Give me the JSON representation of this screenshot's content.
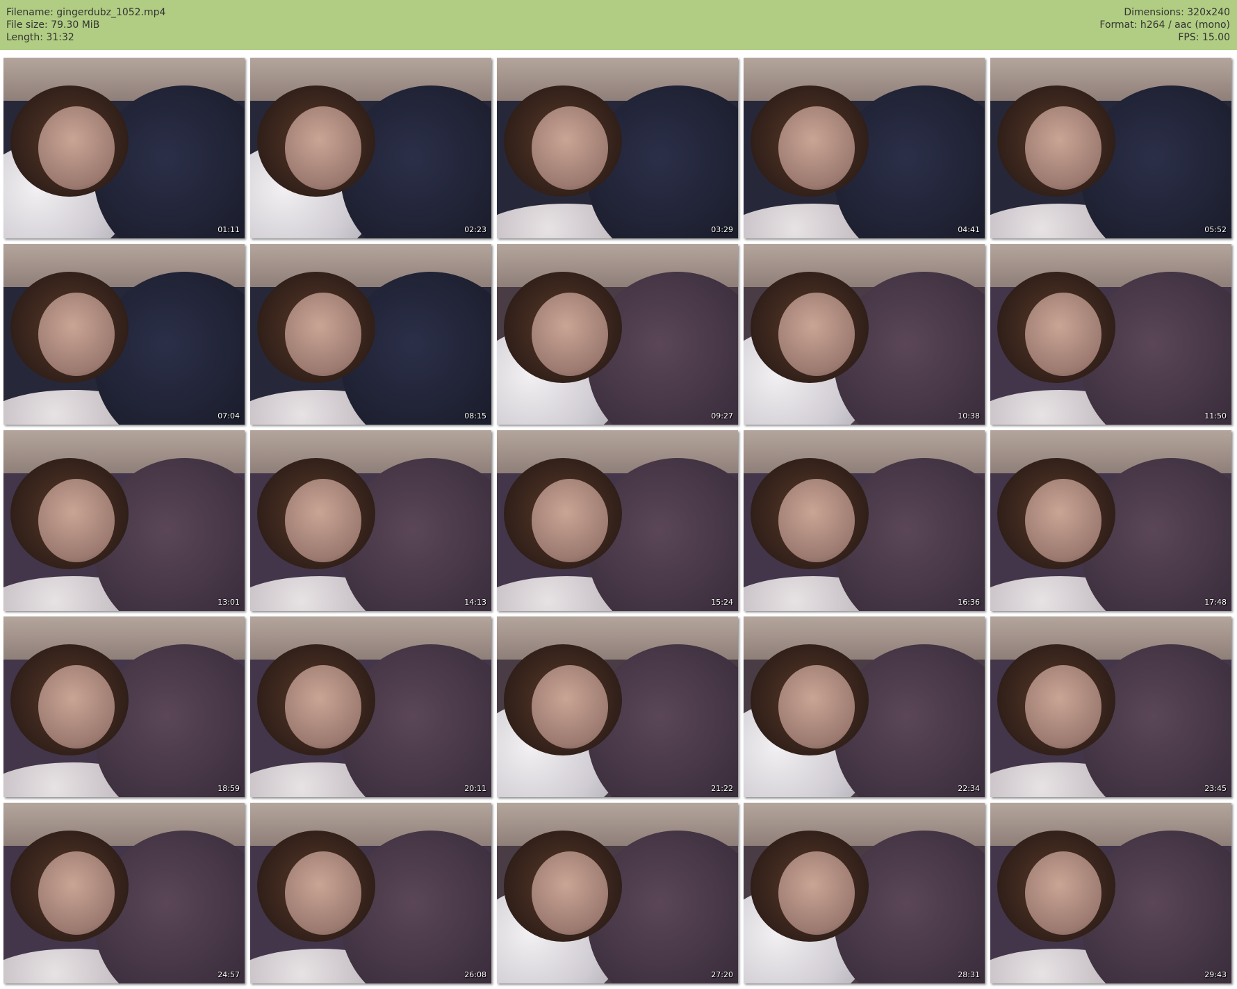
{
  "header": {
    "left": [
      {
        "label": "Filename: ",
        "value": "gingerdubz_1052.mp4"
      },
      {
        "label": "File size: ",
        "value": "79.30 MiB"
      },
      {
        "label": "Length: ",
        "value": "31:32"
      }
    ],
    "right": [
      {
        "label": "Dimensions: ",
        "value": "320x240"
      },
      {
        "label": "Format: ",
        "value": "h264 / aac (mono)"
      },
      {
        "label": "FPS: ",
        "value": "15.00"
      }
    ]
  },
  "colors": {
    "header_bg": "#b1cd83",
    "header_text": "#333333"
  },
  "thumbnails": [
    {
      "time": "01:11",
      "scene": "hoodie-pillow"
    },
    {
      "time": "02:23",
      "scene": "hoodie-pillow"
    },
    {
      "time": "03:29",
      "scene": "hoodie-dark"
    },
    {
      "time": "04:41",
      "scene": "hoodie-dark"
    },
    {
      "time": "05:52",
      "scene": "hoodie-dark"
    },
    {
      "time": "07:04",
      "scene": "hoodie-dark"
    },
    {
      "time": "08:15",
      "scene": "hoodie-dark"
    },
    {
      "time": "09:27",
      "scene": "blanket-pillow"
    },
    {
      "time": "10:38",
      "scene": "blanket-pillow"
    },
    {
      "time": "11:50",
      "scene": "blanket-close"
    },
    {
      "time": "13:01",
      "scene": "blanket-close"
    },
    {
      "time": "14:13",
      "scene": "blanket-close"
    },
    {
      "time": "15:24",
      "scene": "blanket-close"
    },
    {
      "time": "16:36",
      "scene": "blanket-close"
    },
    {
      "time": "17:48",
      "scene": "blanket-close"
    },
    {
      "time": "18:59",
      "scene": "blanket-close"
    },
    {
      "time": "20:11",
      "scene": "blanket-close"
    },
    {
      "time": "21:22",
      "scene": "blanket-pillow"
    },
    {
      "time": "22:34",
      "scene": "blanket-pillow"
    },
    {
      "time": "23:45",
      "scene": "blanket-close"
    },
    {
      "time": "24:57",
      "scene": "blanket-close"
    },
    {
      "time": "26:08",
      "scene": "blanket-close"
    },
    {
      "time": "27:20",
      "scene": "blanket-pillow"
    },
    {
      "time": "28:31",
      "scene": "blanket-pillow"
    },
    {
      "time": "29:43",
      "scene": "blanket-close"
    }
  ]
}
